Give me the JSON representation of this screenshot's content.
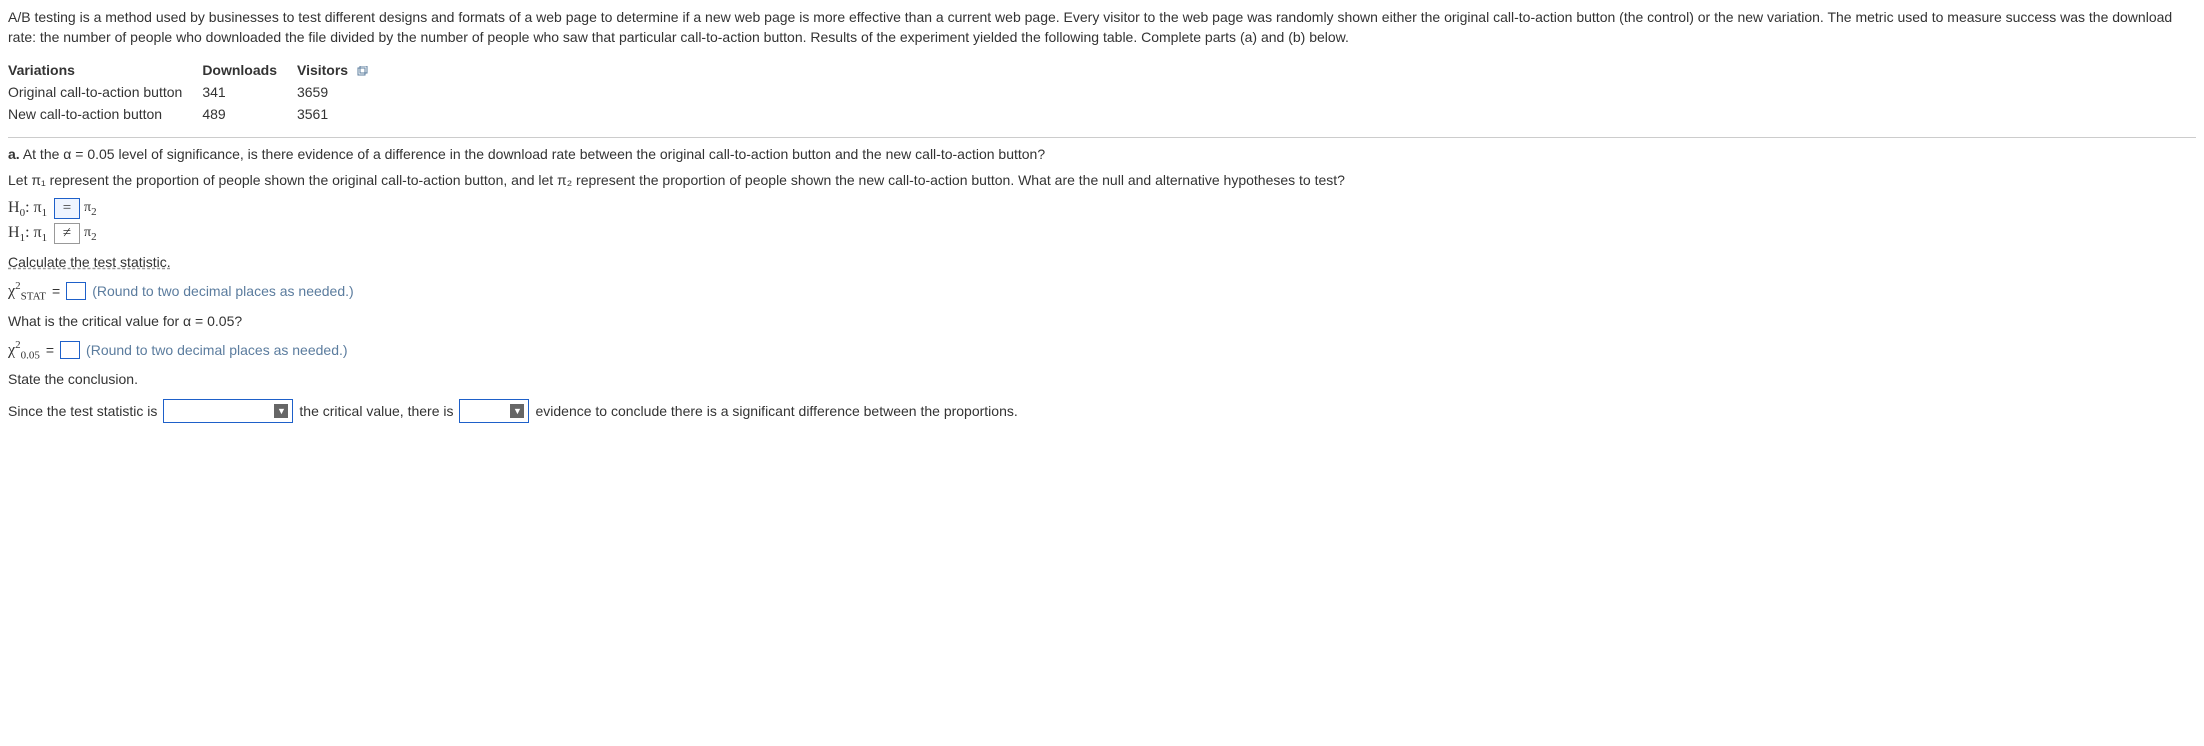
{
  "intro": "A/B testing is a method used by businesses to test different designs and formats of a web page to determine if a new web page is more effective than a current web page. Every visitor to the web page was randomly shown either the original call-to-action button (the control) or the new variation. The metric used to measure success was the download rate: the number of people who downloaded the file divided by the number of people who saw that particular call-to-action button. Results of the experiment yielded the following table. Complete parts (a) and (b) below.",
  "table": {
    "headers": {
      "variations": "Variations",
      "downloads": "Downloads",
      "visitors": "Visitors"
    },
    "rows": [
      {
        "variation": "Original call-to-action button",
        "downloads": "341",
        "visitors": "3659"
      },
      {
        "variation": "New call-to-action button",
        "downloads": "489",
        "visitors": "3561"
      }
    ]
  },
  "part_a": {
    "prefix": "a.",
    "question": "At the α = 0.05 level of significance, is there evidence of a difference in the download rate between the original call-to-action button and the new call-to-action button?"
  },
  "let_line": "Let π₁ represent the proportion of people shown the original call-to-action button, and let π₂ represent the proportion of people shown the new call-to-action button. What are the null and alternative hypotheses to test?",
  "hypotheses": {
    "h0_label": "H₀: π₁",
    "h0_op": "=",
    "h0_rhs": "π₂",
    "h1_label": "H₁: π₁",
    "h1_op": "≠",
    "h1_rhs": "π₂"
  },
  "calc_prompt": "Calculate the test statistic.",
  "chi_stat_label": "χ",
  "chi_stat_sub": "STAT",
  "equals": "=",
  "round_hint": "(Round to two decimal places as needed.)",
  "crit_prompt": "What is the critical value for α = 0.05?",
  "chi_crit_sub": "0.05",
  "state_prompt": "State the conclusion.",
  "conclusion": {
    "s1": "Since the test statistic is",
    "s2": "the critical value, there is",
    "s3": "evidence to conclude there is a significant difference between the proportions."
  }
}
